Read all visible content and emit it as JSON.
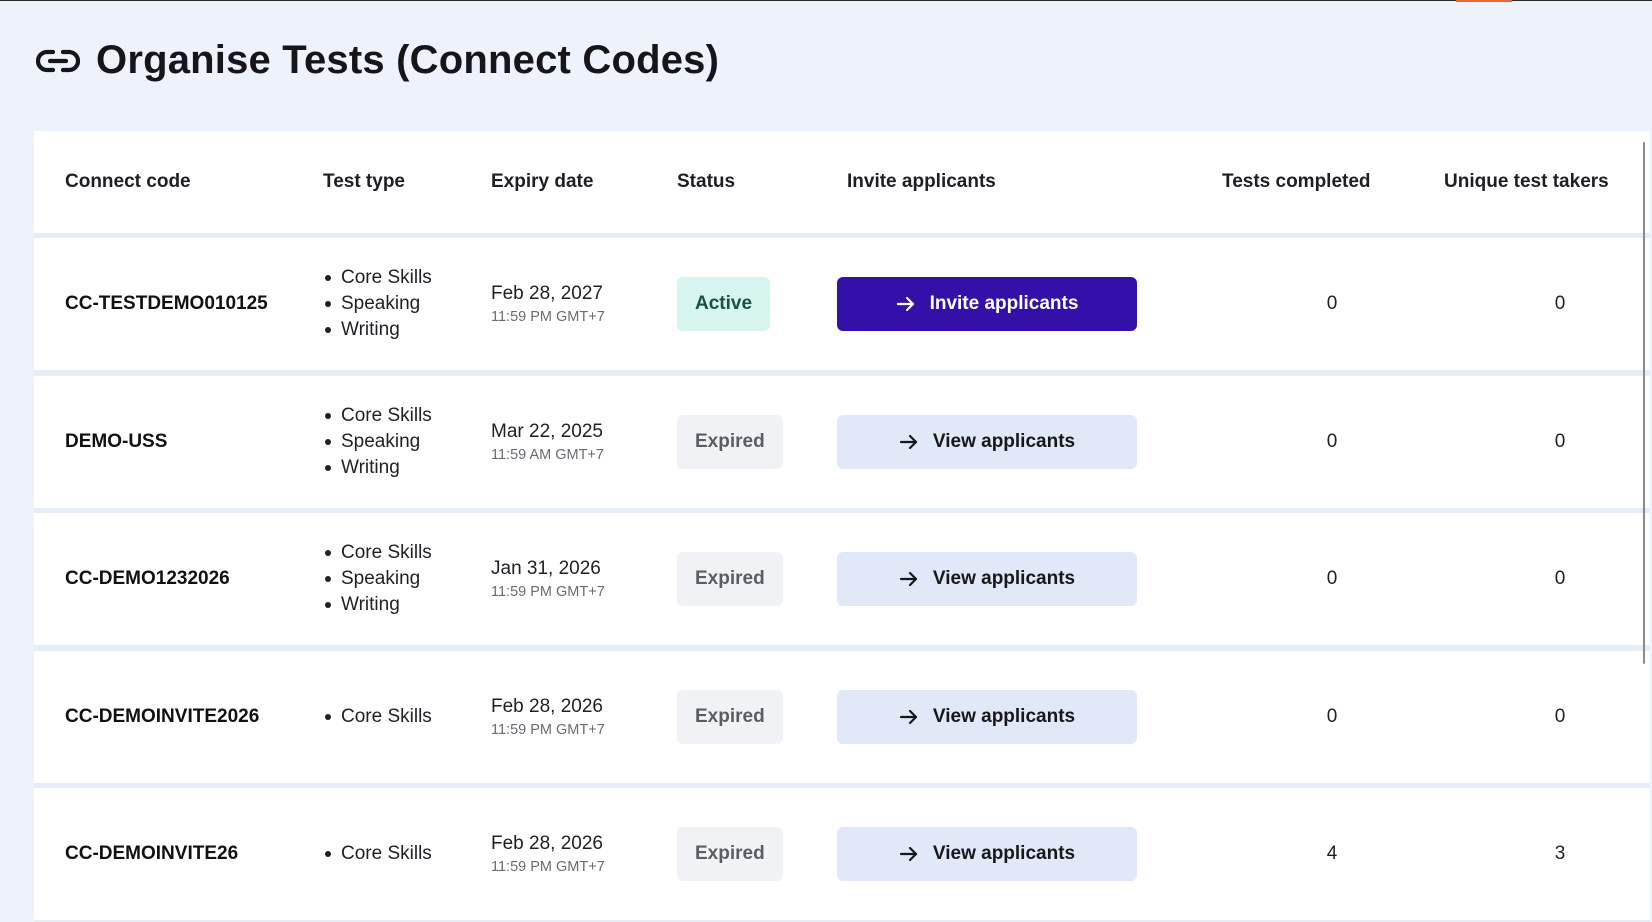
{
  "page": {
    "title": "Organise Tests (Connect Codes)",
    "icon": "link-icon"
  },
  "colors": {
    "background": "#eef3fb",
    "primary_button": "#3310a8",
    "secondary_button": "#e1e8f8",
    "active_badge": "#d6f5ef",
    "expired_badge": "#f1f2f5"
  },
  "table": {
    "headers": {
      "connect_code": "Connect code",
      "test_type": "Test type",
      "expiry_date": "Expiry date",
      "status": "Status",
      "invite": "Invite applicants",
      "tests_completed": "Tests completed",
      "unique_takers": "Unique test takers"
    },
    "rows": [
      {
        "code": "CC-TESTDEMO010125",
        "test_types": [
          "Core Skills",
          "Speaking",
          "Writing"
        ],
        "expiry_date": "Feb 28, 2027",
        "expiry_time": "11:59 PM GMT+7",
        "status": "Active",
        "action_label": "Invite applicants",
        "tests_completed": "0",
        "unique_takers": "0"
      },
      {
        "code": "DEMO-USS",
        "test_types": [
          "Core Skills",
          "Speaking",
          "Writing"
        ],
        "expiry_date": "Mar 22, 2025",
        "expiry_time": "11:59 AM GMT+7",
        "status": "Expired",
        "action_label": "View applicants",
        "tests_completed": "0",
        "unique_takers": "0"
      },
      {
        "code": "CC-DEMO1232026",
        "test_types": [
          "Core Skills",
          "Speaking",
          "Writing"
        ],
        "expiry_date": "Jan 31, 2026",
        "expiry_time": "11:59 PM GMT+7",
        "status": "Expired",
        "action_label": "View applicants",
        "tests_completed": "0",
        "unique_takers": "0"
      },
      {
        "code": "CC-DEMOINVITE2026",
        "test_types": [
          "Core Skills"
        ],
        "expiry_date": "Feb 28, 2026",
        "expiry_time": "11:59 PM GMT+7",
        "status": "Expired",
        "action_label": "View applicants",
        "tests_completed": "0",
        "unique_takers": "0"
      },
      {
        "code": "CC-DEMOINVITE26",
        "test_types": [
          "Core Skills"
        ],
        "expiry_date": "Feb 28, 2026",
        "expiry_time": "11:59 PM GMT+7",
        "status": "Expired",
        "action_label": "View applicants",
        "tests_completed": "4",
        "unique_takers": "3"
      }
    ]
  }
}
